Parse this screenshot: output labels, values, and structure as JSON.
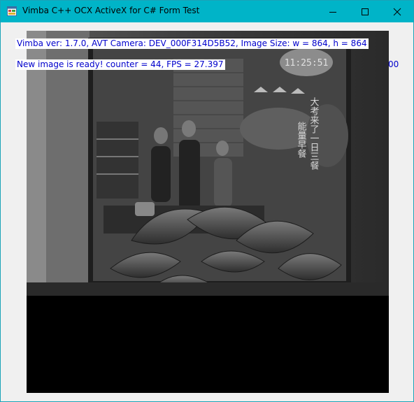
{
  "window": {
    "title": "Vimba C++ OCX ActiveX for C# Form Test",
    "app_icon": "form-app-icon",
    "controls": {
      "minimize_icon": "minimize-icon",
      "maximize_icon": "maximize-icon",
      "close_icon": "close-icon"
    },
    "colors": {
      "titlebar": "#00b4c8",
      "label_text": "#0000cc",
      "label_background": "#ffffff",
      "client_background": "#f0f0f0"
    }
  },
  "overlay": {
    "info": "Vimba ver: 1.7.0, AVT Camera: DEV_000F314D5B52, Image Size: w = 864, h = 864",
    "status": "New image is ready! counter = 44, FPS = 27.397",
    "stray": "00"
  },
  "camera_frame": {
    "description_icon": "camera-image",
    "clock_text": "11:25:51",
    "sign_text_col1": "大考来了一日三餐",
    "sign_text_col2": "能量早餐"
  }
}
